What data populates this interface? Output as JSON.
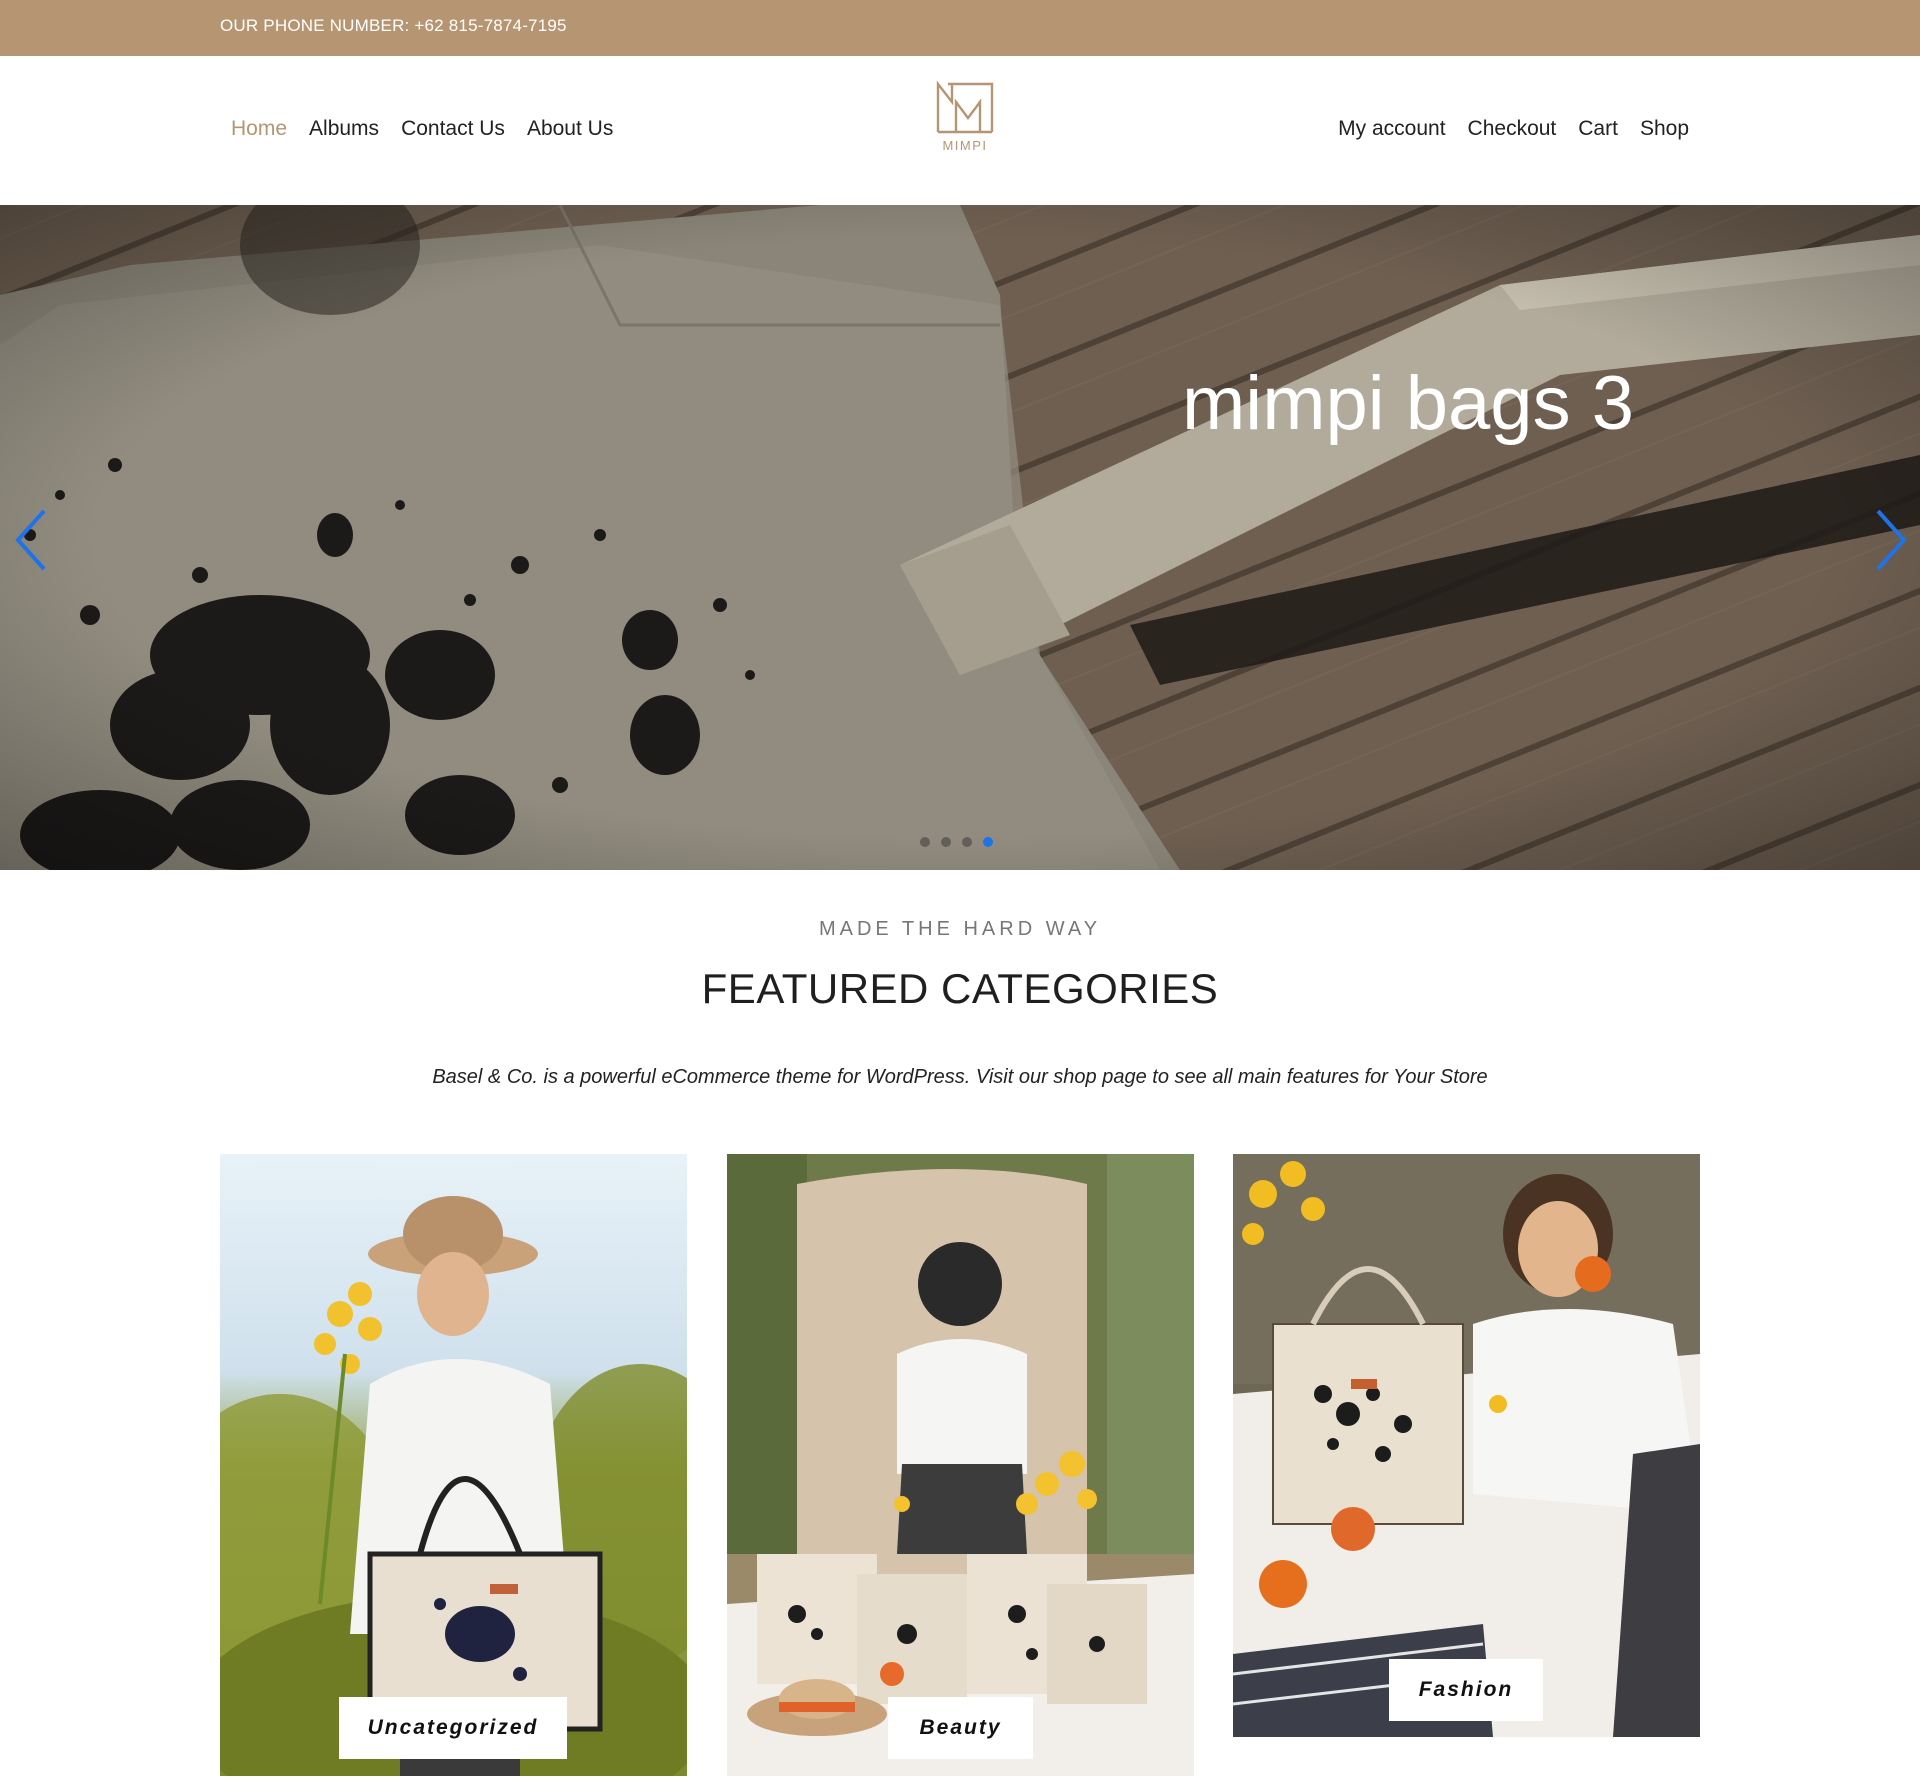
{
  "topbar": {
    "phone": "OUR PHONE NUMBER: +62 815-7874-7195"
  },
  "header": {
    "nav_left": [
      {
        "label": "Home",
        "active": true
      },
      {
        "label": "Albums"
      },
      {
        "label": "Contact Us"
      },
      {
        "label": "About Us"
      }
    ],
    "nav_right": [
      {
        "label": "My account"
      },
      {
        "label": "Checkout"
      },
      {
        "label": "Cart"
      },
      {
        "label": "Shop"
      }
    ],
    "logo": {
      "text": "MIMPI",
      "icon": "mimpi-logo-icon"
    }
  },
  "hero": {
    "title": "mimpi bags 3",
    "prev_icon": "chevron-left-icon",
    "next_icon": "chevron-right-icon",
    "slides_total": 4,
    "active_slide": 4
  },
  "featured": {
    "eyebrow": "MADE THE HARD WAY",
    "title": "FEATURED CATEGORIES",
    "description": "Basel & Co. is a powerful eCommerce theme for WordPress. Visit our shop page to see all main features for Your Store",
    "categories": [
      {
        "label": "Uncategorized"
      },
      {
        "label": "Beauty"
      },
      {
        "label": "Fashion"
      }
    ]
  },
  "colors": {
    "accent": "#b69672",
    "slider_active": "#1e73e8"
  }
}
